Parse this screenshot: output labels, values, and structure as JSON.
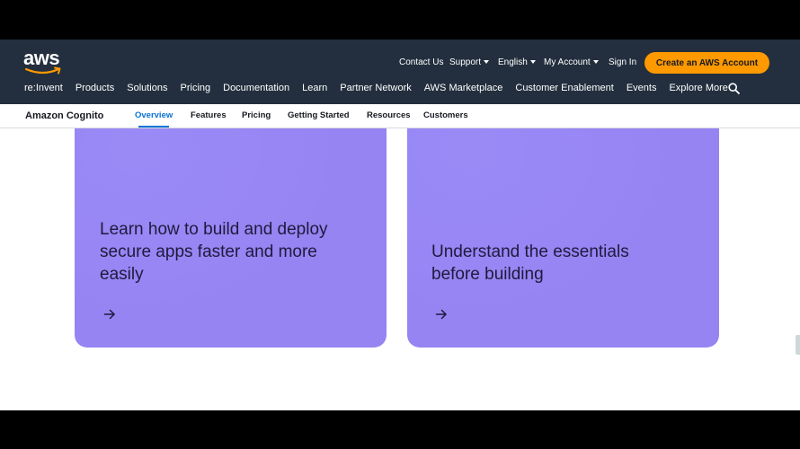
{
  "brand": {
    "logo_text": "aws"
  },
  "header": {
    "utility_links": [
      {
        "label": "Contact Us",
        "has_caret": false
      },
      {
        "label": "Support",
        "has_caret": true
      },
      {
        "label": "English",
        "has_caret": true
      },
      {
        "label": "My Account",
        "has_caret": true
      },
      {
        "label": "Sign In",
        "has_caret": false
      }
    ],
    "cta_label": "Create an AWS Account",
    "main_nav": [
      "re:Invent",
      "Products",
      "Solutions",
      "Pricing",
      "Documentation",
      "Learn",
      "Partner Network",
      "AWS Marketplace",
      "Customer Enablement",
      "Events",
      "Explore More"
    ]
  },
  "subnav": {
    "product": "Amazon Cognito",
    "tabs": [
      "Overview",
      "Features",
      "Pricing",
      "Getting Started",
      "Resources",
      "Customers"
    ],
    "active_tab": "Overview"
  },
  "cards": [
    {
      "title_lines": [
        "Learn how to build and deploy",
        "secure apps faster and more",
        "easily"
      ]
    },
    {
      "title_lines": [
        "Understand the essentials",
        "before building"
      ]
    }
  ],
  "colors": {
    "header_bg": "#232f3e",
    "cta_bg": "#ff9900",
    "active_tab": "#0972d3",
    "card_bg": "#9684f2"
  }
}
